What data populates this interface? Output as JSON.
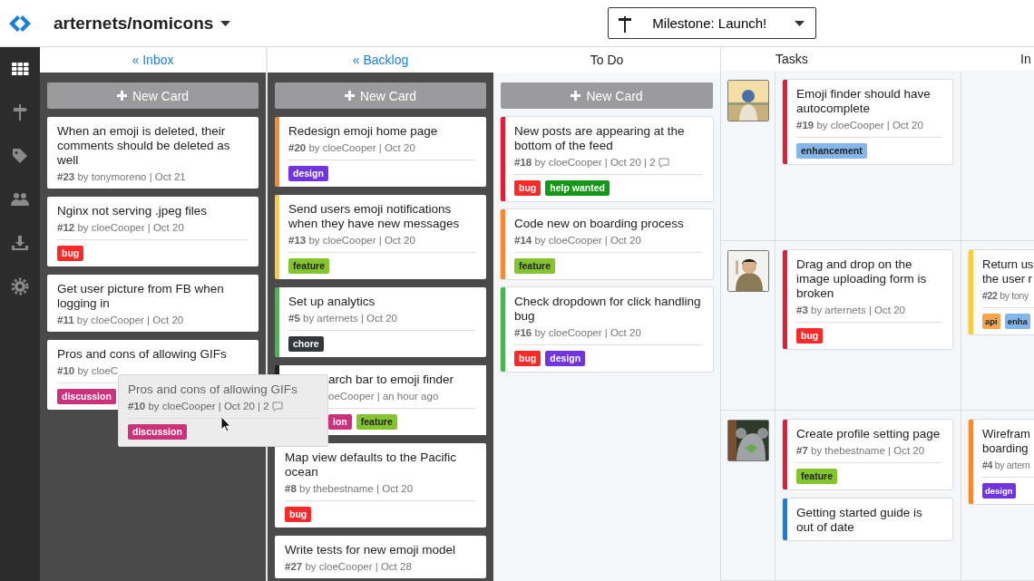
{
  "header": {
    "repo": "arternets/nomicons",
    "milestone": "Milestone: Launch!"
  },
  "sidebar": {
    "items": [
      {
        "kind": "grid",
        "selected": true
      },
      {
        "kind": "signpost",
        "selected": false
      },
      {
        "kind": "tag",
        "selected": false
      },
      {
        "kind": "people",
        "selected": false
      },
      {
        "kind": "download",
        "selected": false
      },
      {
        "kind": "gear",
        "selected": false
      }
    ]
  },
  "columns": [
    {
      "title": "« Inbox",
      "kind": "link",
      "dark": true,
      "button": "New Card",
      "cards": [
        {
          "title": "When an emoji is deleted, their comments should be deleted as well",
          "meta": "**#23** by tonymoreno | Oct 21"
        },
        {
          "title": "Nginx not serving .jpeg files",
          "meta": "**#12** by cloeCooper | Oct 20",
          "labels": [
            {
              "text": "bug",
              "color": "#fc2929"
            }
          ]
        },
        {
          "title": "Get user picture from FB when logging in",
          "meta": "**#11** by cloeCooper | Oct 20"
        },
        {
          "title": "Pros and cons of allowing GIFs",
          "meta": "**#10** by cloeC",
          "labels": [
            {
              "text": "discussion",
              "color": "#cc317c"
            }
          ]
        }
      ]
    },
    {
      "title": "« Backlog",
      "kind": "link",
      "dark": true,
      "button": "New Card",
      "cards": [
        {
          "title": "Redesign emoji home page",
          "meta": "**#20** by cloeCooper | Oct 20",
          "color": "#f7892f",
          "labels": [
            {
              "text": "design",
              "color": "#7233e0"
            }
          ]
        },
        {
          "title": "Send users emoji notifications when they have new messages",
          "meta": "**#13** by cloeCooper | Oct 20",
          "color": "#fbca3f",
          "labels": [
            {
              "text": "feature",
              "color": "#84c52d"
            }
          ]
        },
        {
          "title": "Set up analytics",
          "meta": "**#5** by arternets | Oct 20",
          "color": "#47b84a",
          "labels": [
            {
              "text": "chore",
              "color": "#33383b"
            }
          ]
        },
        {
          "title": "arch bar to emoji finder",
          "meta": "oeCooper | an hour ago",
          "covered": true,
          "labels": [
            {
              "text": "ion",
              "color": "#cc317c"
            },
            {
              "text": "feature",
              "color": "#84c52d"
            }
          ]
        },
        {
          "title": "Map view defaults to the Pacific ocean",
          "meta": "**#8** by thebestname | Oct 20",
          "labels": [
            {
              "text": "bug",
              "color": "#fc2929"
            }
          ]
        },
        {
          "title": "Write tests for new emoji model",
          "meta": "**#27** by cloeCooper | Oct 28"
        }
      ]
    },
    {
      "title": "To Do",
      "kind": "plain",
      "dark": false,
      "button": "New Card",
      "cards": [
        {
          "title": "New posts are appearing at the bottom of the feed",
          "meta": "**#18** by cloeCooper | Oct 20 | 2",
          "comment_icon": true,
          "color": "#e01f36",
          "labels": [
            {
              "text": "bug",
              "color": "#fc2929"
            },
            {
              "text": "help wanted",
              "color": "#159818"
            }
          ]
        },
        {
          "title": "Code new on boarding process",
          "meta": "**#14** by cloeCooper | Oct 20",
          "color": "#f7892f",
          "labels": [
            {
              "text": "feature",
              "color": "#84c52d"
            }
          ]
        },
        {
          "title": "Check dropdown for click handling bug",
          "meta": "**#16** by cloeCooper | Oct 20",
          "color": "#47b84a",
          "labels": [
            {
              "text": "bug",
              "color": "#fc2929"
            },
            {
              "text": "design",
              "color": "#7233e0"
            }
          ]
        }
      ]
    }
  ],
  "swimlanes": {
    "columns": [
      {
        "title": "Tasks"
      },
      {
        "title": "In"
      }
    ],
    "lanes": [
      {
        "cells": [
          [
            {
              "title": "Emoji finder should have autocomplete",
              "meta": "**#19** by cloeCooper | Oct 20",
              "color": "#e01f36",
              "labels": [
                {
                  "text": "enhancement",
                  "color": "#84b6eb"
                }
              ]
            }
          ],
          []
        ]
      },
      {
        "cells": [
          [
            {
              "title": "Drag and drop on the image uploading form is broken",
              "meta": "**#3** by arternets | Oct 20",
              "color": "#e01f36",
              "labels": [
                {
                  "text": "bug",
                  "color": "#fc2929"
                }
              ]
            }
          ],
          [
            {
              "title": "Return us\nthe user r",
              "meta": "**#22** by tony",
              "color": "#fbca3f",
              "labels": [
                {
                  "text": "api",
                  "color": "#f6a54a"
                },
                {
                  "text": "enha",
                  "color": "#84b6eb"
                }
              ]
            }
          ]
        ]
      },
      {
        "cells": [
          [
            {
              "title": "Create profile setting page",
              "meta": "**#7** by thebestname | Oct 20",
              "color": "#e01f36",
              "labels": [
                {
                  "text": "feature",
                  "color": "#84c52d"
                }
              ]
            },
            {
              "title": "Getting started guide is out of date",
              "color": "#1a7fdc"
            }
          ],
          [
            {
              "title": "Wirefram\nboarding",
              "meta": "**#4** by artern",
              "color": "#f7892f",
              "labels": [
                {
                  "text": "design",
                  "color": "#7233e0"
                }
              ]
            }
          ]
        ]
      }
    ]
  },
  "drag_preview": {
    "title": "Pros and cons of allowing GIFs",
    "meta": "**#10** by cloeCooper | Oct 20 | 2",
    "comment_icon": true,
    "labels": [
      {
        "text": "discussion",
        "color": "#cc317c"
      }
    ]
  }
}
